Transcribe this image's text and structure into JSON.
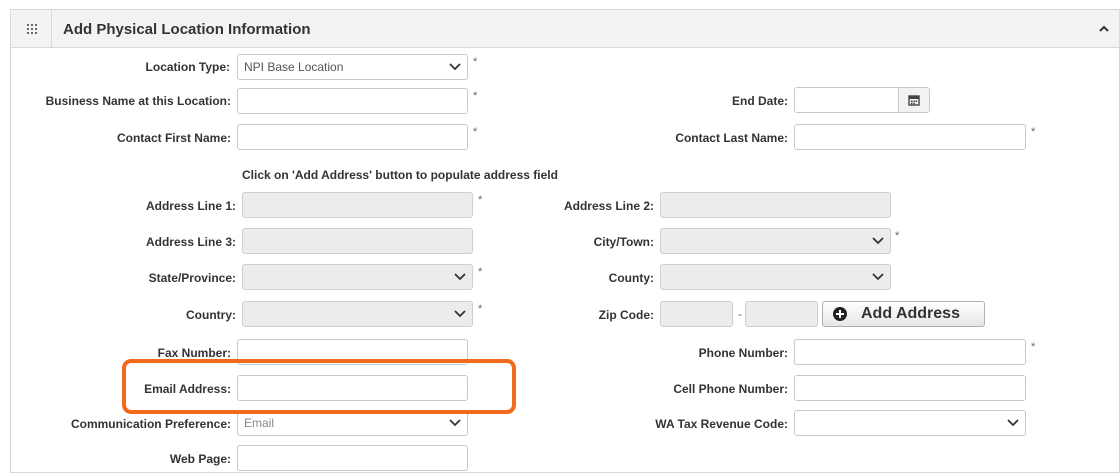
{
  "panel": {
    "title": "Add Physical Location Information"
  },
  "form": {
    "location_type_label": "Location Type:",
    "location_type_value": "NPI Base Location",
    "business_name_label": "Business Name at this Location:",
    "end_date_label": "End Date:",
    "contact_first_label": "Contact First Name:",
    "contact_last_label": "Contact Last Name:",
    "address_hint": "Click on 'Add Address' button to populate address field",
    "address1_label": "Address Line 1:",
    "address2_label": "Address Line 2:",
    "address3_label": "Address Line 3:",
    "city_label": "City/Town:",
    "state_label": "State/Province:",
    "county_label": "County:",
    "country_label": "Country:",
    "zip_label": "Zip Code:",
    "zip_dash": "-",
    "add_address_label": "Add Address",
    "fax_label": "Fax Number:",
    "phone_label": "Phone Number:",
    "email_label": "Email Address:",
    "cell_label": "Cell Phone Number:",
    "comm_pref_label": "Communication Preference:",
    "comm_pref_value": "Email",
    "wa_tax_label": "WA Tax Revenue Code:",
    "web_page_label": "Web Page:",
    "required_mark": "*"
  },
  "icons": {
    "grid": "grid-icon",
    "collapse": "chevron-up-icon",
    "calendar": "calendar-icon",
    "add": "plus-circle-icon",
    "dropdown": "chevron-down-icon"
  },
  "colors": {
    "highlight": "#f26b1d",
    "header_bg": "#f3f3f3",
    "disabled_bg": "#ececec"
  }
}
